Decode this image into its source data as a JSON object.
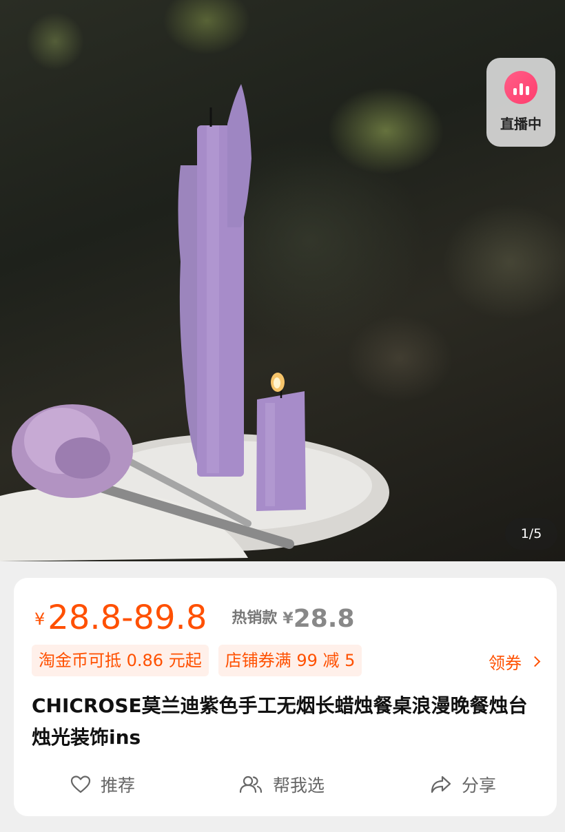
{
  "gallery": {
    "live_badge_label": "直播中",
    "page_indicator": "1/5"
  },
  "product": {
    "currency_symbol": "¥",
    "price_range": "28.8-89.8",
    "hot_label": "热销款",
    "hot_currency_symbol": "¥",
    "hot_price": "28.8",
    "promotions": [
      "淘金币可抵 0.86 元起",
      "店铺券满 99 减 5"
    ],
    "coupon_link": "领券",
    "title": "CHICROSE莫兰迪紫色手工无烟长蜡烛餐桌浪漫晚餐烛台烛光装饰ins"
  },
  "actions": {
    "recommend_label": "推荐",
    "help_choose_label": "帮我选",
    "share_label": "分享"
  },
  "colors": {
    "accent": "#ff5000",
    "live_icon": "#ff4d79",
    "promo_bg": "#fff0ea",
    "candle": "#a78cc9"
  },
  "icons": {
    "live": "live-chart-icon",
    "recommend": "heart-icon",
    "help_choose": "users-icon",
    "share": "share-arrow-icon",
    "coupon": "chevron-right-icon"
  }
}
